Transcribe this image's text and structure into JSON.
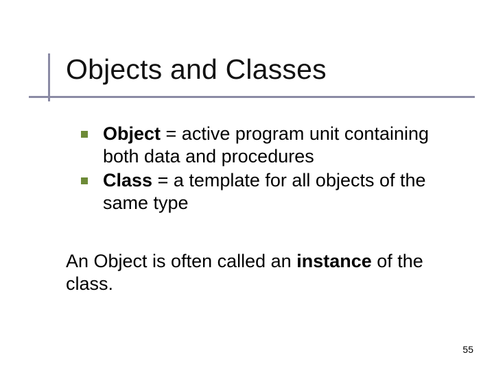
{
  "title": "Objects and Classes",
  "bullets": [
    {
      "term": "Object",
      "rest": " = active program unit containing both data and procedures"
    },
    {
      "term": "Class",
      "rest": " = a template for all objects of the same type"
    }
  ],
  "paragraph": {
    "pre": "An Object is often called an ",
    "bold": "instance",
    "post": " of the class."
  },
  "page": "55"
}
